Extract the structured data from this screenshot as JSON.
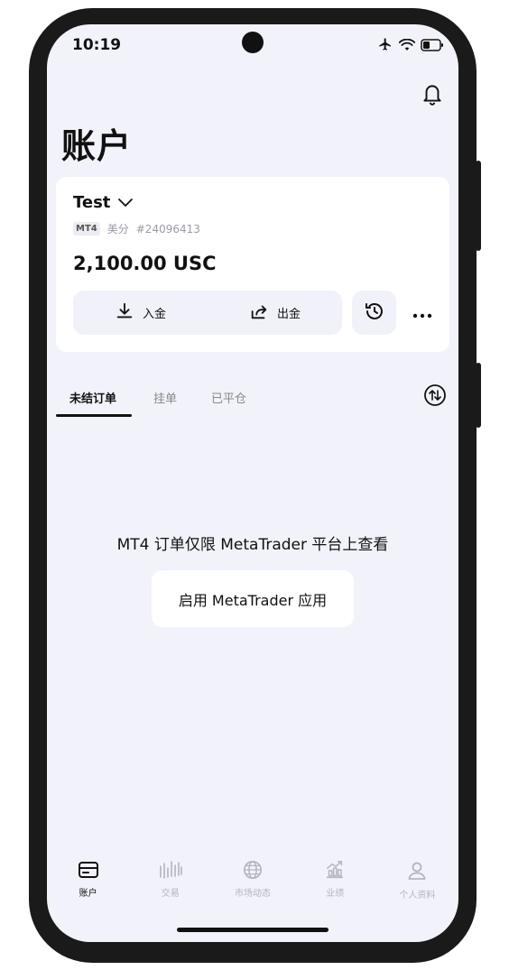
{
  "status_bar": {
    "time": "10:19",
    "icons": [
      "airplane-icon",
      "wifi-icon",
      "battery-icon"
    ]
  },
  "header": {
    "title": "账户",
    "notification_icon": "bell-icon"
  },
  "account_card": {
    "name": "Test",
    "platform": "MT4",
    "account_type": "美分",
    "account_number": "#24096413",
    "balance": "2,100.00 USC",
    "deposit_label": "入金",
    "withdraw_label": "出金",
    "history_icon": "history-icon",
    "more_icon": "more-icon"
  },
  "tabs": {
    "items": [
      {
        "label": "未结订单",
        "active": true
      },
      {
        "label": "挂单",
        "active": false
      },
      {
        "label": "已平仓",
        "active": false
      }
    ],
    "sort_icon": "sort-icon"
  },
  "empty_state": {
    "message": "MT4 订单仅限 MetaTrader 平台上查看",
    "button_label": "启用 MetaTrader 应用"
  },
  "bottom_nav": {
    "items": [
      {
        "label": "账户",
        "icon": "wallet-icon",
        "active": true
      },
      {
        "label": "交易",
        "icon": "candles-icon",
        "active": false
      },
      {
        "label": "市场动态",
        "icon": "globe-icon",
        "active": false
      },
      {
        "label": "业绩",
        "icon": "performance-icon",
        "active": false
      },
      {
        "label": "个人资料",
        "icon": "profile-icon",
        "active": false
      }
    ]
  },
  "colors": {
    "background": "#f2f2fb",
    "card": "#ffffff",
    "text": "#111111",
    "muted": "#9a9aa6",
    "inactive_nav": "#b4b4bf"
  }
}
